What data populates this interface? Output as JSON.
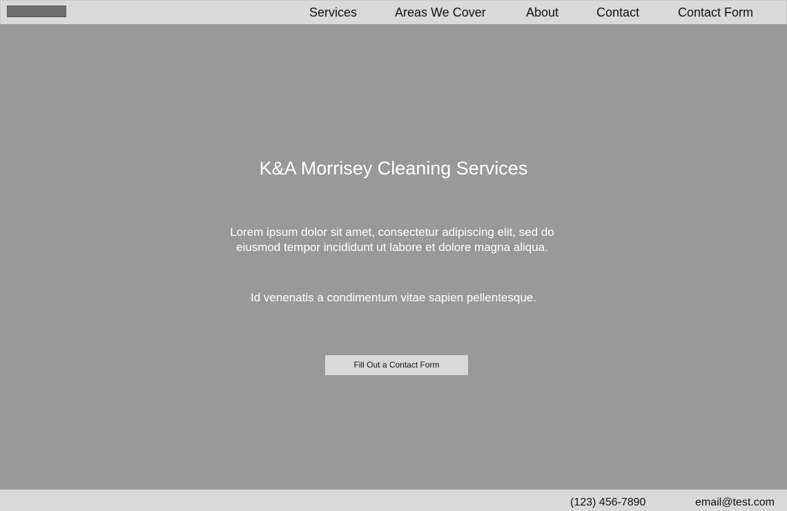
{
  "header": {
    "logo_icon": "logo-placeholder",
    "nav": {
      "services": "Services",
      "areas": "Areas We Cover",
      "about": "About",
      "contact": "Contact",
      "contact_form": "Contact Form"
    }
  },
  "hero": {
    "title": "K&A Morrisey Cleaning Services",
    "body": "Lorem ipsum dolor sit amet, consectetur adipiscing elit, sed do eiusmod tempor incididunt ut labore et dolore magna aliqua.",
    "subtext": "Id venenatis a condimentum vitae sapien pellentesque.",
    "cta_label": "Fill Out a Contact Form"
  },
  "footer": {
    "phone": "(123) 456-7890",
    "email": "email@test.com"
  },
  "colors": {
    "header_bg": "#d9d9d9",
    "hero_bg": "#999999",
    "logo": "#6e6e6e",
    "button_bg": "#d9d9d9",
    "hero_text": "#ffffff"
  }
}
